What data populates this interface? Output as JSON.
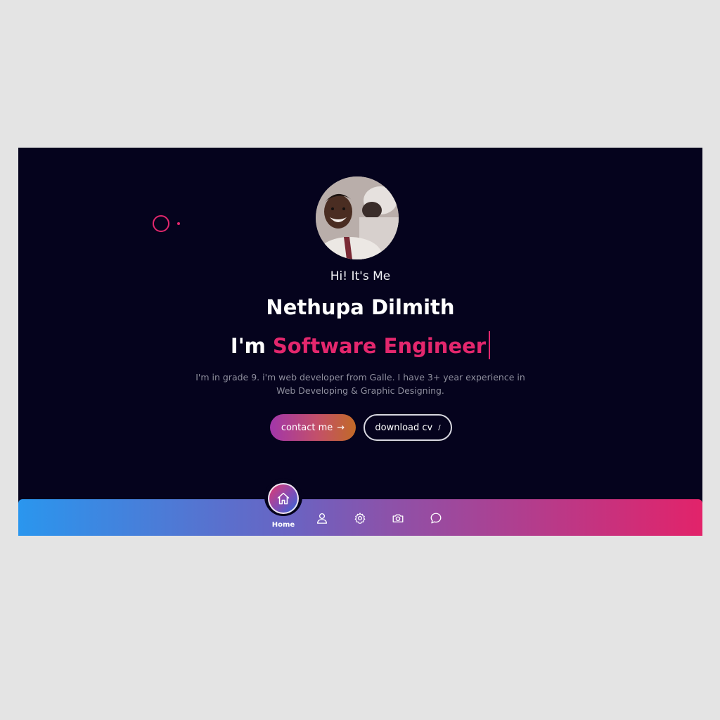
{
  "hero": {
    "greeting": "Hi! It's Me",
    "name": "Nethupa Dilmith",
    "role_prefix": "I'm",
    "role": "Software Engineer",
    "bio_line1": "I'm in grade 9. i'm web developer from Galle. I have 3+ year experience in",
    "bio_line2": "Web Developing & Graphic Designing."
  },
  "buttons": {
    "contact_label": "contact me",
    "contact_glyph": "→",
    "cv_label": "download cv",
    "cv_glyph": "/"
  },
  "nav": {
    "home_label": "Home",
    "icons": [
      "home-icon",
      "user-icon",
      "gear-icon",
      "camera-icon",
      "chat-icon"
    ]
  },
  "colors": {
    "background": "#05031d",
    "accent": "#e3276d",
    "nav_gradient_start": "#2a96ee",
    "nav_gradient_end": "#e2236a"
  }
}
